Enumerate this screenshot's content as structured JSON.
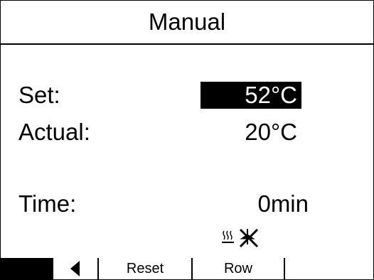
{
  "title": "Manual",
  "fields": {
    "set": {
      "label": "Set:",
      "value": "52°C"
    },
    "actual": {
      "label": "Actual:",
      "value": "20°C"
    },
    "time": {
      "label": "Time:",
      "value": "0min"
    }
  },
  "status_icons": [
    "heating-icon",
    "stirring-off-icon"
  ],
  "softkeys": {
    "back": {
      "icon": "arrow-left-icon"
    },
    "reset": {
      "label": "Reset"
    },
    "row": {
      "label": "Row"
    },
    "blank": {
      "label": ""
    }
  },
  "colors": {
    "foreground": "#000000",
    "background": "#ffffff"
  }
}
